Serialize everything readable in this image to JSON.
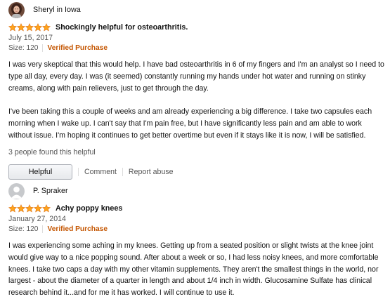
{
  "colors": {
    "star": "#ffa41c",
    "verified": "#c45500",
    "muted_text": "#555555"
  },
  "reviews": [
    {
      "author": "Sheryl in Iowa",
      "avatar_icon": "user-photo-avatar",
      "rating": 5,
      "title": "Shockingly helpful for osteoarthritis.",
      "date": "July 15, 2017",
      "size": "Size: 120",
      "verified": "Verified Purchase",
      "paragraphs": [
        "I was very skeptical that this would help. I have bad osteoarthritis in 6 of my fingers and I'm an analyst so I need to type all day, every day. I was (it seemed) constantly running my hands under hot water and running on stinky creams, along with pain relievers, just to get through the day.",
        "I've been taking this a couple of weeks and am already experiencing a big difference. I take two capsules each morning when I wake up. I can't say that I'm pain free, but I have significantly less pain and am able to work without issue. I'm hoping it continues to get better overtime but even if it stays like it is now, I will be satisfied."
      ],
      "helpful_count": "3 people found this helpful",
      "helpful_button": "Helpful",
      "comment_link": "Comment",
      "report_link": "Report abuse"
    },
    {
      "author": "P. Spraker",
      "avatar_icon": "default-user-avatar",
      "rating": 5,
      "title": "Achy poppy knees",
      "date": "January 27, 2014",
      "size": "Size: 120",
      "verified": "Verified Purchase",
      "paragraphs": [
        "I was experiencing some aching in my knees. Getting up from a seated position or slight twists at the knee joint would give way to a nice popping sound. After about a week or so, I had less noisy knees, and more comfortable knees. I take two caps a day with my other vitamin supplements. They aren't the smallest things in the world, nor largest - about the diameter of a quarter in length and about 1/4 inch in width. Glucosamine Sulfate has clinical research behind it...and for me it has worked. I will continue to use it."
      ]
    }
  ]
}
